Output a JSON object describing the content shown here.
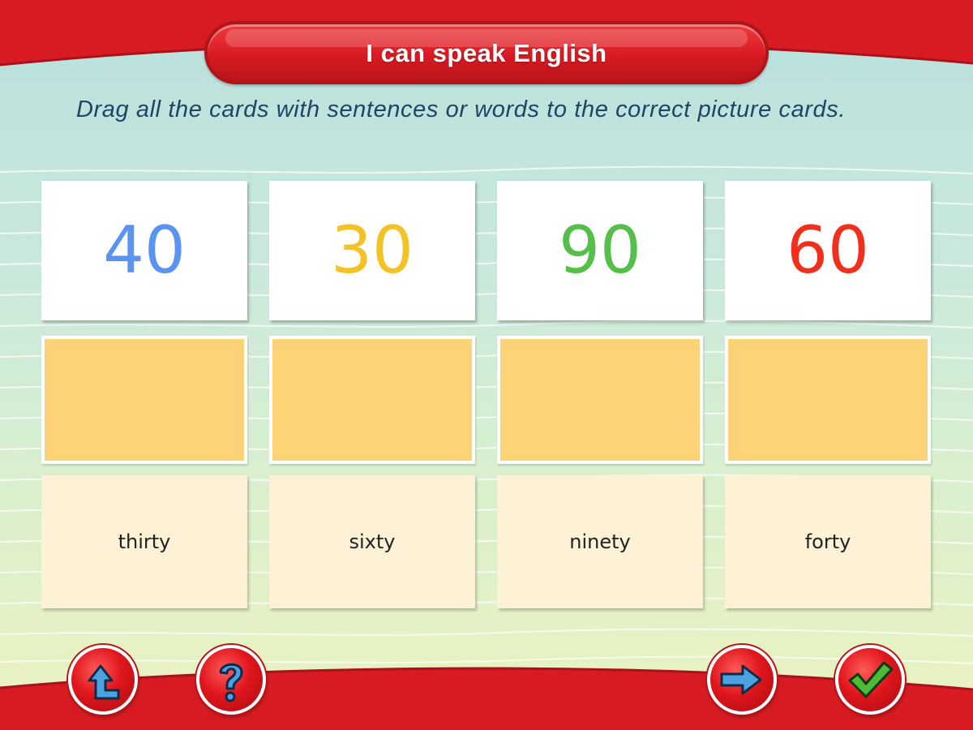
{
  "header": {
    "title": "I can speak English"
  },
  "instruction": "Drag all the cards with sentences or words to the correct picture cards.",
  "picture_cards": [
    {
      "label": "40",
      "color": "#5b93f0"
    },
    {
      "label": "30",
      "color": "#f5c225"
    },
    {
      "label": "90",
      "color": "#56bf4a"
    },
    {
      "label": "60",
      "color": "#f0301b"
    }
  ],
  "word_cards": [
    {
      "label": "thirty"
    },
    {
      "label": "sixty"
    },
    {
      "label": "ninety"
    },
    {
      "label": "forty"
    }
  ],
  "buttons": {
    "back": {
      "icon": "back-arrow-icon",
      "color": "#4aa3e0"
    },
    "help": {
      "icon": "question-mark-icon",
      "color": "#4aa3e0"
    },
    "next": {
      "icon": "right-arrow-icon",
      "color": "#4aa3e0"
    },
    "check": {
      "icon": "checkmark-icon",
      "color": "#4dbb37"
    }
  },
  "colors": {
    "accent_red": "#d81b22",
    "drop_zone": "#fdd377",
    "word_card": "#fdf1d6",
    "instruction_text": "#1f4566"
  }
}
